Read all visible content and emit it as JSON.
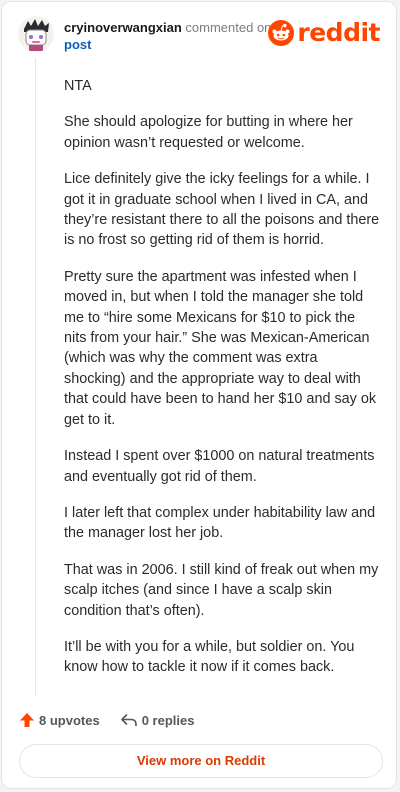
{
  "header": {
    "author": "cryinoverwangxian",
    "action_text": "commented on",
    "post_link": "post",
    "logo_text": "reddit",
    "avatar_icon": "avatar-sticker",
    "logo_icon": "reddit-snoo-icon"
  },
  "comment": {
    "paragraphs": [
      "NTA",
      "She should apologize for butting in where her opinion wasn’t requested or welcome.",
      "Lice definitely give the icky feelings for a while. I got it in graduate school when I lived in CA, and they’re resistant there to all the poisons and there is no frost so getting rid of them is horrid.",
      "Pretty sure the apartment was infested when I moved in, but when I told the manager she told me to “hire some Mexicans for $10 to pick the nits from your hair.” She was Mexican-American (which was why the comment was extra shocking) and the appropriate way to deal with that could have been to hand her $10 and say ok get to it.",
      "Instead I spent over $1000 on natural treatments and eventually got rid of them.",
      "I later left that complex under habitability law and the manager lost her job.",
      "That was in 2006. I still kind of freak out when my scalp itches (and since I have a scalp skin condition that’s often).",
      "It’ll be with you for a while, but soldier on. You know how to tackle it now if it comes back."
    ]
  },
  "actions": {
    "upvotes_label": "8 upvotes",
    "replies_label": "0 replies",
    "view_more_label": "View more on Reddit"
  },
  "colors": {
    "brand": "#ff4500",
    "link": "#0a5fbd",
    "view_more": "#d93a00"
  }
}
